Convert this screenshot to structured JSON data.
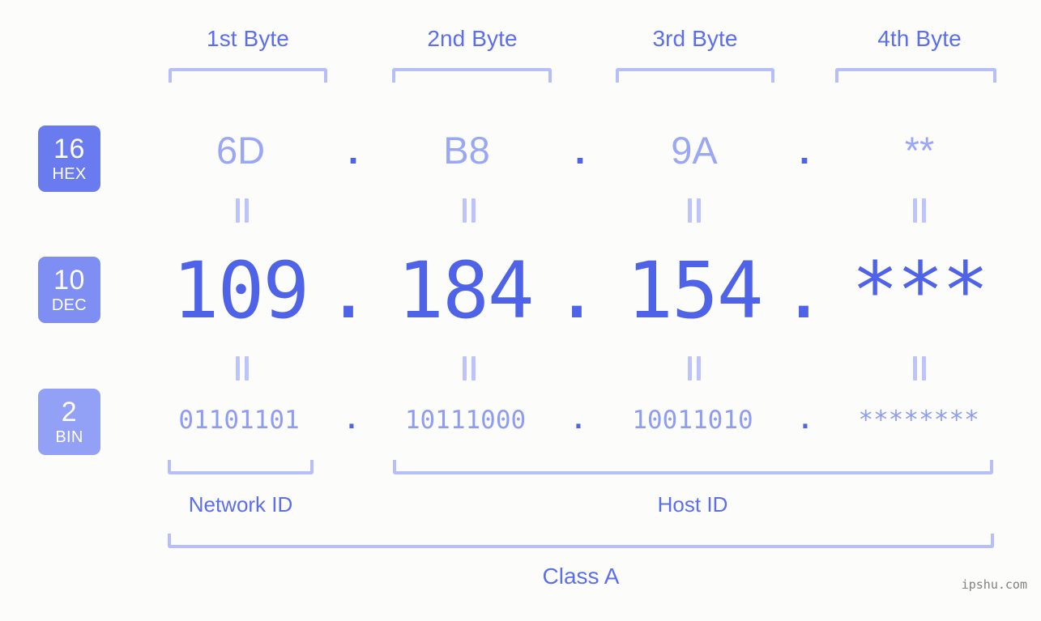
{
  "meta": {
    "background_color": "#fcfdfa",
    "accent_strong": "#4f63e8",
    "accent_mid": "#5b6ef0",
    "accent_light": "#9aa7f5",
    "bracket_color": "#b6bffa"
  },
  "byte_headers": [
    {
      "label": "1st Byte"
    },
    {
      "label": "2nd Byte"
    },
    {
      "label": "3rd Byte"
    },
    {
      "label": "4th Byte"
    }
  ],
  "rows": {
    "hex": {
      "badge": {
        "number": "16",
        "name": "HEX",
        "color": "#6a7bef"
      },
      "values": [
        "6D",
        "B8",
        "9A",
        "**"
      ],
      "separator": "."
    },
    "dec": {
      "badge": {
        "number": "10",
        "name": "DEC",
        "color": "#7f8ef3"
      },
      "values": [
        "109",
        "184",
        "154",
        "***"
      ],
      "separator": "."
    },
    "bin": {
      "badge": {
        "number": "2",
        "name": "BIN",
        "color": "#92a0f6"
      },
      "values": [
        "01101101",
        "10111000",
        "10011010",
        "********"
      ],
      "separator": "."
    }
  },
  "equals_symbol": "=",
  "sections": {
    "network_id": {
      "label": "Network ID"
    },
    "host_id": {
      "label": "Host ID"
    },
    "class": {
      "label": "Class A"
    }
  },
  "watermark": {
    "text": "ipshu.com"
  }
}
